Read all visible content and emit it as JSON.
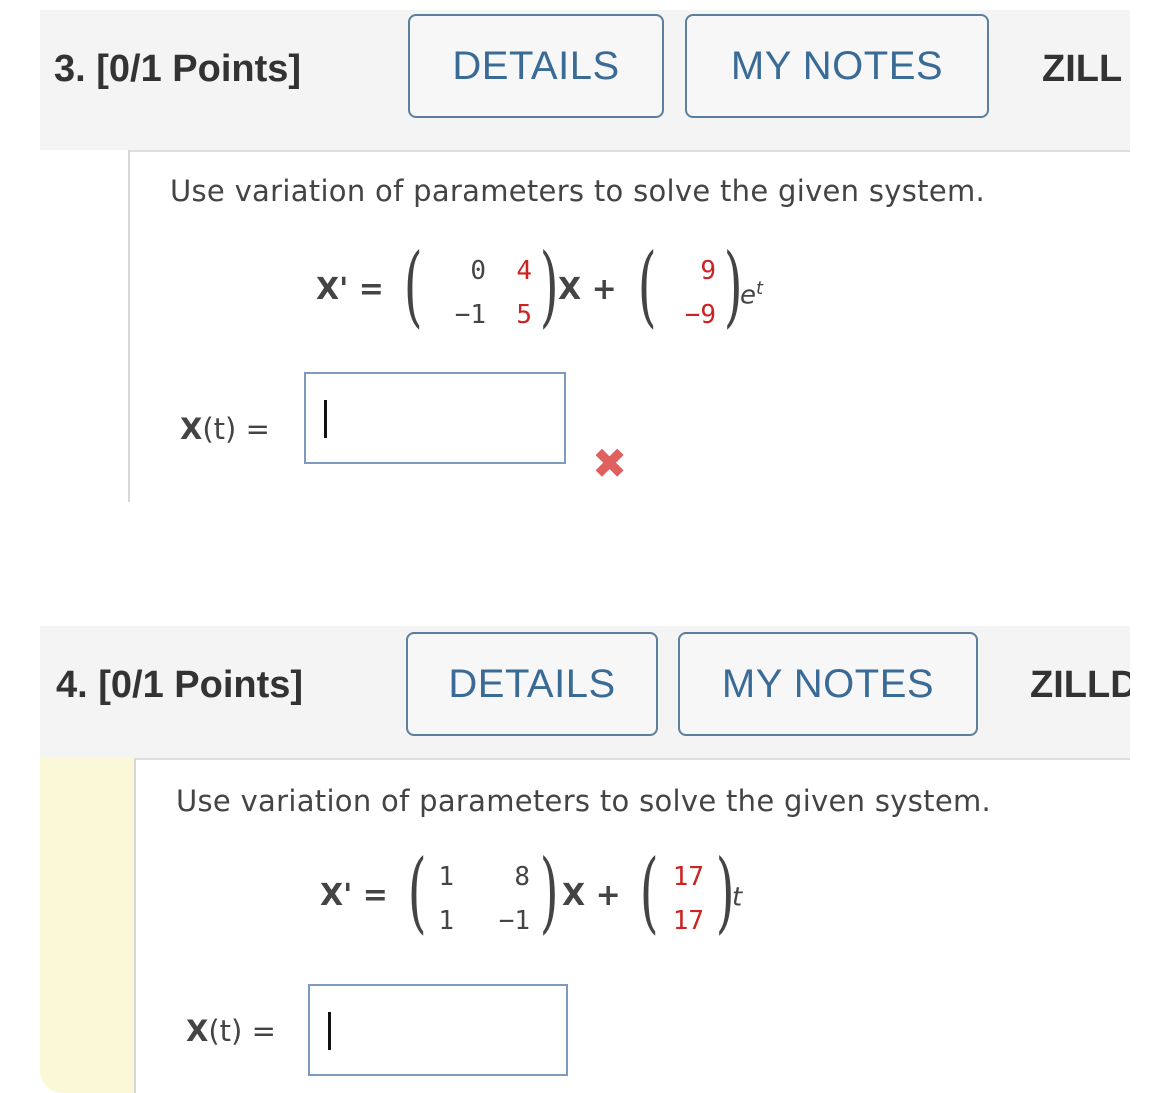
{
  "questions": [
    {
      "title": "3. [0/1 Points]",
      "details_label": "DETAILS",
      "notes_label": "MY NOTES",
      "source_label": "ZILL",
      "prompt": "Use variation of parameters to solve the given system.",
      "lhs": "X' =",
      "matrix": [
        [
          "0",
          "4"
        ],
        [
          "−1",
          "5"
        ]
      ],
      "plus": "X +",
      "vector": [
        "9",
        "−9"
      ],
      "forcing": "e",
      "forcing_sup": "t",
      "answer_label_x": "X",
      "answer_label_rest": "(t) =",
      "answer_value": "",
      "status": "incorrect",
      "status_icon": "cross-icon",
      "status_color": "#e06060",
      "body_bar_color": "#ffffff"
    },
    {
      "title": "4. [0/1 Points]",
      "details_label": "DETAILS",
      "notes_label": "MY NOTES",
      "source_label": "ZILLD",
      "prompt": "Use variation of parameters to solve the given system.",
      "lhs": "X' =",
      "matrix": [
        [
          "1",
          "8"
        ],
        [
          "1",
          "−1"
        ]
      ],
      "plus": "X +",
      "vector": [
        "17",
        "17"
      ],
      "forcing": "t",
      "forcing_sup": "",
      "answer_label_x": "X",
      "answer_label_rest": "(t) =",
      "answer_value": "",
      "status": "",
      "body_bar_color": "#fbf8d8"
    }
  ],
  "colors": {
    "button_text": "#3a6b96",
    "button_border": "#5b7f9c",
    "red_value": "#cc2222",
    "header_bg": "#f4f4f4"
  }
}
